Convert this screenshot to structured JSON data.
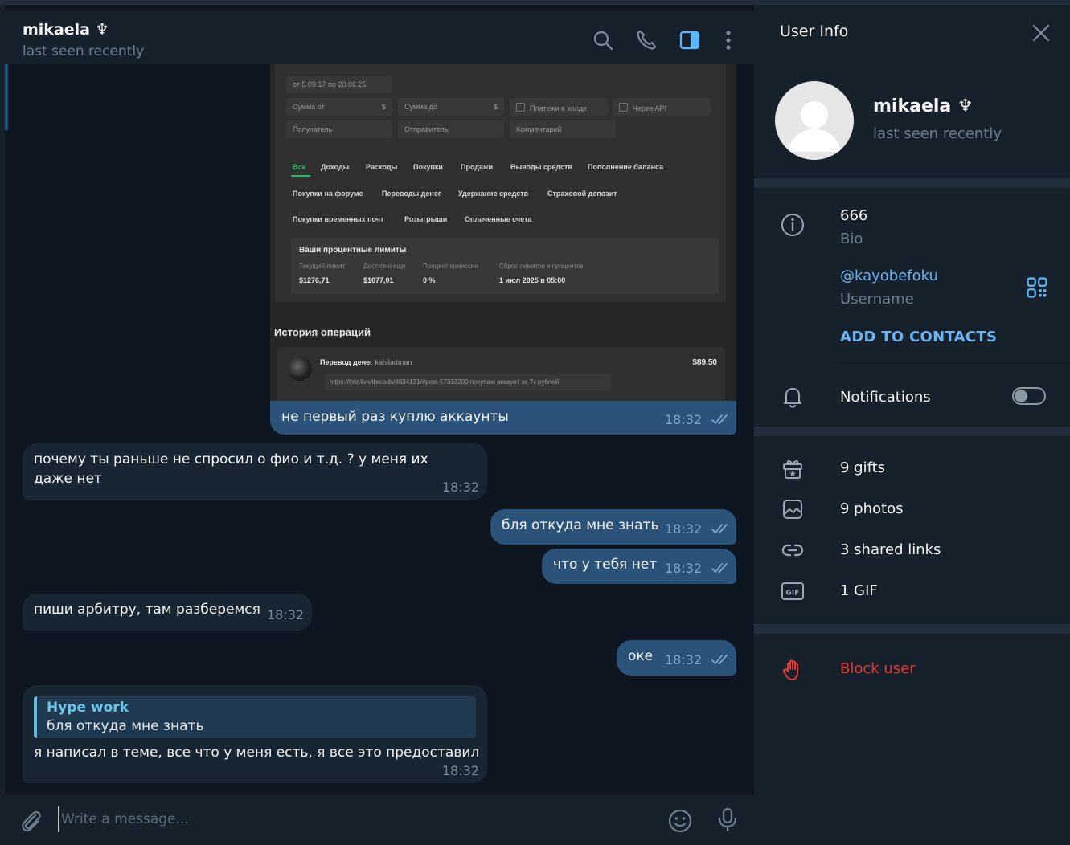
{
  "chat": {
    "contact_name": "mikaela ♆",
    "contact_status": "last seen recently",
    "composer_placeholder": "Write a message..."
  },
  "screenshot": {
    "date_range": "от 5.09.17 по 20.06.25",
    "filters": {
      "amount_from": "Сумма от",
      "amount_to": "Сумма до",
      "currency": "$",
      "hold": "Платежи в холде",
      "via_api": "Через API",
      "recipient": "Получатель",
      "sender": "Отправитель",
      "comment": "Комментарий"
    },
    "tabs_row1": [
      "Все",
      "Доходы",
      "Расходы",
      "Покупки",
      "Продажи",
      "Выводы средств",
      "Пополнение баланса"
    ],
    "tabs_row2": [
      "Покупки на форуме",
      "Переводы денег",
      "Удержание средств",
      "Страховой депозит"
    ],
    "tabs_row3": [
      "Покупки временных почт",
      "Розыгрыши",
      "Оплаченные счета"
    ],
    "limits": {
      "title": "Ваши процентные лимиты",
      "labels": [
        "Текущий лимит",
        "Доступно еще",
        "Процент комиссии",
        "Сброс лимитов и процентов"
      ],
      "values": [
        "$1276,71",
        "$1077,01",
        "0 %",
        "1 июл 2025 в 05:00"
      ]
    },
    "history_title": "История операций",
    "operation": {
      "type": "Перевод денег",
      "user": "kahiladman",
      "amount": "$89,50",
      "link": "https://lolz.live/threads/8834131/#post-57333200 покупаю аккаунт за 7к рублей"
    }
  },
  "messages": [
    {
      "dir": "out",
      "text": "не первый раз куплю аккаунты",
      "time": "18:32"
    },
    {
      "dir": "in",
      "text": "почему ты раньше не спросил о фио и т.д. ? у меня их даже нет",
      "time": "18:32"
    },
    {
      "dir": "out",
      "text": "бля откуда мне знать",
      "time": "18:32"
    },
    {
      "dir": "out",
      "text": "что у тебя нет",
      "time": "18:32"
    },
    {
      "dir": "in",
      "text": "пиши арбитру, там разберемся",
      "time": "18:32"
    },
    {
      "dir": "out",
      "text": "оке",
      "time": "18:32"
    },
    {
      "dir": "in",
      "reply_name": "Hype work",
      "reply_text": "бля откуда мне знать",
      "text": "я написал в теме, все что у меня есть, я все это предоставил",
      "time": "18:32"
    }
  ],
  "info": {
    "title": "User Info",
    "name": "mikaela ♆",
    "status": "last seen recently",
    "bio_value": "666",
    "bio_label": "Bio",
    "username_value": "@kayobefoku",
    "username_label": "Username",
    "add_to_contacts": "ADD TO CONTACTS",
    "notifications_label": "Notifications",
    "notifications_on": false,
    "gifts": "9 gifts",
    "photos": "9 photos",
    "links": "3 shared links",
    "gifs": "1 GIF",
    "block": "Block user"
  },
  "colors": {
    "chat_bg": "#0e1621",
    "panel_bg": "#17212b",
    "outgoing_bubble": "#2b5278",
    "incoming_bubble": "#182533",
    "accent": "#6ab2f2",
    "danger": "#e53935"
  },
  "icons": [
    "search-icon",
    "phone-icon",
    "sidebar-toggle-icon",
    "more-vertical-icon",
    "close-icon",
    "info-icon",
    "qr-code-icon",
    "bell-icon",
    "gift-icon",
    "photo-icon",
    "link-icon",
    "gif-icon",
    "hand-icon",
    "attach-icon",
    "emoji-icon",
    "microphone-icon",
    "double-check-icon"
  ]
}
